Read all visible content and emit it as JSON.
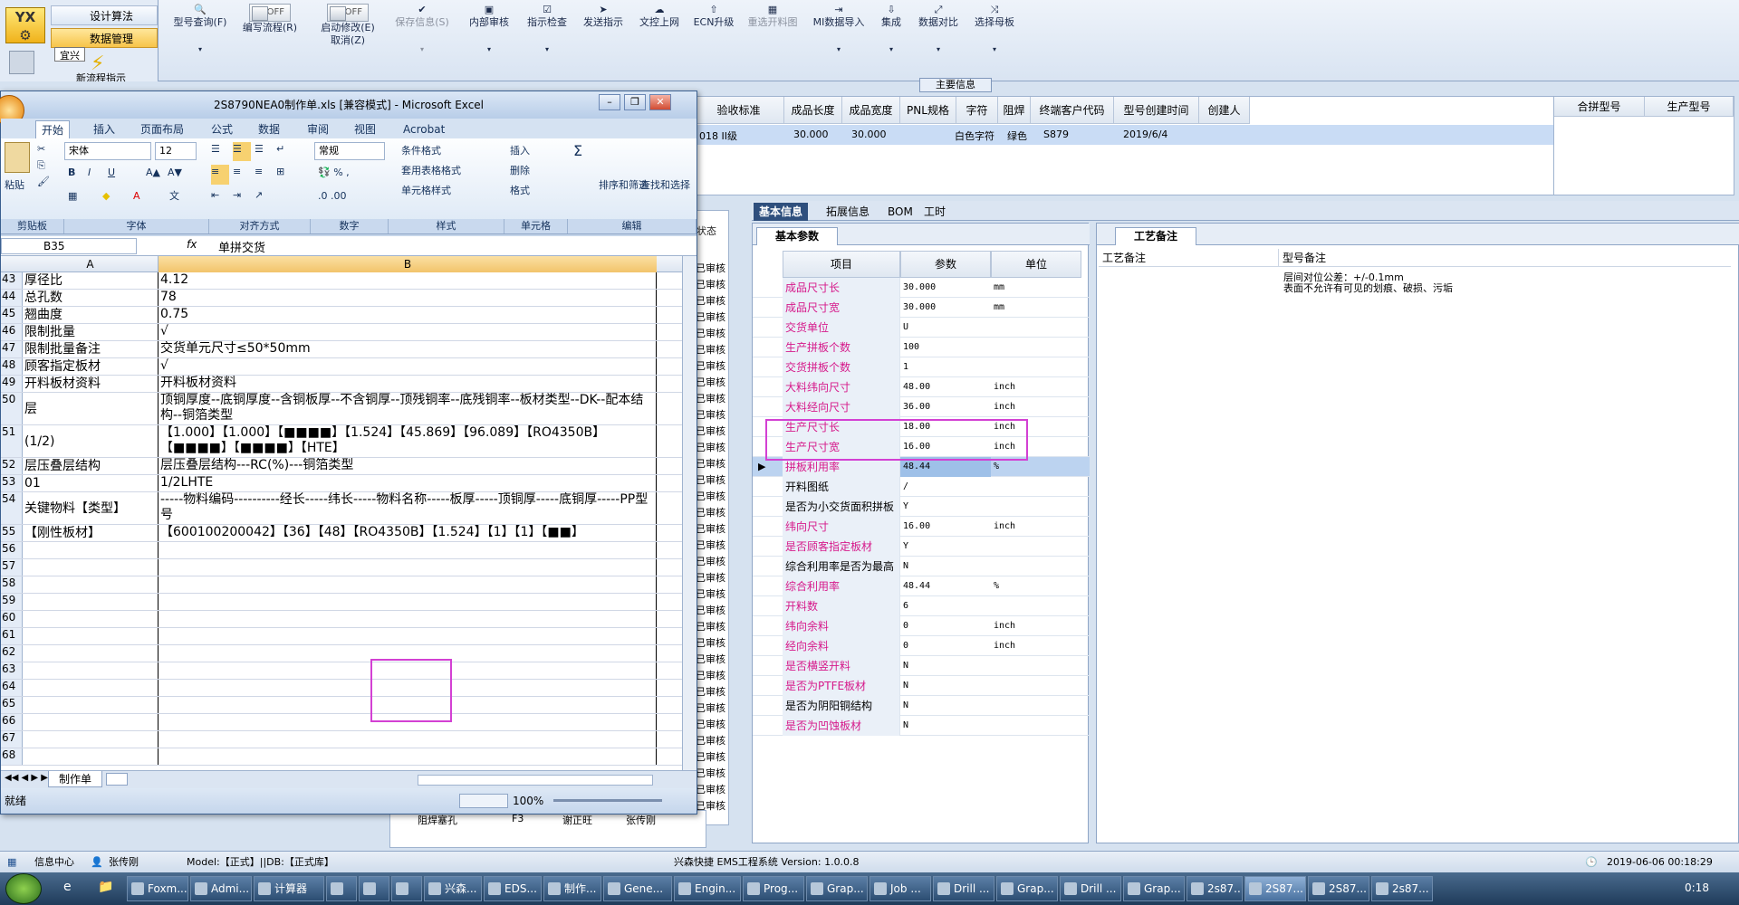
{
  "app_ribbon": {
    "nav": {
      "design": "设计算法",
      "data_mgmt": "数据管理",
      "tooltip": "宜兴",
      "new_flow": "新流程指示"
    },
    "buttons": [
      {
        "label": "型号查询(F)",
        "icon": "search-icon"
      },
      {
        "label": "编写流程(R)",
        "toggle": "OFF"
      },
      {
        "label": "启动修改(E)",
        "toggle": "OFF",
        "sub": "取消(Z)"
      },
      {
        "label": "保存信息(S)",
        "disabled": true
      },
      {
        "label": "内部审核"
      },
      {
        "label": "指示检查"
      },
      {
        "label": "发送指示"
      },
      {
        "label": "文控上网"
      },
      {
        "label": "ECN升级"
      },
      {
        "label": "重选开料图",
        "disabled": true
      },
      {
        "label": "MI数据导入"
      },
      {
        "label": "集成"
      },
      {
        "label": "数据对比"
      },
      {
        "label": "选择母板"
      }
    ],
    "main_info": "主要信息"
  },
  "top_grid": {
    "headers": [
      "验收标准",
      "成品长度",
      "成品宽度",
      "PNL规格",
      "字符",
      "阻焊",
      "终端客户代码",
      "型号创建时间",
      "创建人"
    ],
    "row": [
      "018 II级",
      "30.000",
      "30.000",
      "",
      "白色字符",
      "绿色",
      "S879",
      "2019/6/4",
      ""
    ],
    "merge_headers": [
      "合拼型号",
      "生产型号"
    ]
  },
  "status_col": {
    "header": "状态",
    "value": "已审核"
  },
  "tabs": [
    "基本信息",
    "拓展信息",
    "BOM",
    "工时"
  ],
  "params": {
    "tab": "基本参数",
    "headers": [
      "项目",
      "参数",
      "单位"
    ],
    "rows": [
      {
        "name": "成品尺寸长",
        "value": "30.000",
        "unit": "mm",
        "pink": true
      },
      {
        "name": "成品尺寸宽",
        "value": "30.000",
        "unit": "mm",
        "pink": true
      },
      {
        "name": "交货单位",
        "value": "U",
        "unit": "",
        "pink": true
      },
      {
        "name": "生产拼板个数",
        "value": "100",
        "unit": "",
        "pink": true
      },
      {
        "name": "交货拼板个数",
        "value": "1",
        "unit": "",
        "pink": true
      },
      {
        "name": "大料纬向尺寸",
        "value": "48.00",
        "unit": "inch",
        "pink": true
      },
      {
        "name": "大料经向尺寸",
        "value": "36.00",
        "unit": "inch",
        "pink": true
      },
      {
        "name": "生产尺寸长",
        "value": "18.00",
        "unit": "inch",
        "pink": true
      },
      {
        "name": "生产尺寸宽",
        "value": "16.00",
        "unit": "inch",
        "pink": true
      },
      {
        "name": "拼板利用率",
        "value": "48.44",
        "unit": "%",
        "pink": true,
        "selected": true
      },
      {
        "name": "开料图纸",
        "value": "/",
        "unit": "",
        "pink": false
      },
      {
        "name": "是否为小交货面积拼板",
        "value": "Y",
        "unit": "",
        "pink": false
      },
      {
        "name": "纬向尺寸",
        "value": "16.00",
        "unit": "inch",
        "pink": true
      },
      {
        "name": "是否顾客指定板材",
        "value": "Y",
        "unit": "",
        "pink": true
      },
      {
        "name": "综合利用率是否为最高",
        "value": "N",
        "unit": "",
        "pink": false
      },
      {
        "name": "综合利用率",
        "value": "48.44",
        "unit": "%",
        "pink": true
      },
      {
        "name": "开料数",
        "value": "6",
        "unit": "",
        "pink": true
      },
      {
        "name": "纬向余料",
        "value": "0",
        "unit": "inch",
        "pink": true
      },
      {
        "name": "经向余料",
        "value": "0",
        "unit": "inch",
        "pink": true
      },
      {
        "name": "是否横竖开料",
        "value": "N",
        "unit": "",
        "pink": true
      },
      {
        "name": "是否为PTFE板材",
        "value": "N",
        "unit": "",
        "pink": true
      },
      {
        "name": "是否为阴阳铜结构",
        "value": "N",
        "unit": "",
        "pink": false
      },
      {
        "name": "是否为凹蚀板材",
        "value": "N",
        "unit": "",
        "pink": true
      }
    ]
  },
  "remarks": {
    "tab": "工艺备注",
    "col1": "工艺备注",
    "col2": "型号备注",
    "text1": "层间对位公差：+/-0.1mm",
    "text2": "表面不允许有可见的划痕、破损、污垢"
  },
  "excel": {
    "title": "2S8790NEA0制作单.xls [兼容模式] - Microsoft Excel",
    "tabs": [
      "开始",
      "插入",
      "页面布局",
      "公式",
      "数据",
      "审阅",
      "视图",
      "Acrobat"
    ],
    "font": "宋体",
    "size": "12",
    "format": "常规",
    "groups": [
      "剪贴板",
      "字体",
      "对齐方式",
      "数字",
      "样式",
      "单元格",
      "编辑"
    ],
    "style_items": [
      "条件格式",
      "套用表格格式",
      "单元格样式"
    ],
    "cell_items": [
      "插入",
      "删除",
      "格式"
    ],
    "edit_items": [
      "排序和筛选",
      "查找和选择"
    ],
    "paste": "粘贴",
    "namebox": "B35",
    "fx": "fx",
    "formula": "单拼交货",
    "colA": "A",
    "colB": "B",
    "rows": [
      {
        "n": "43",
        "a": "厚径比",
        "b": "4.12"
      },
      {
        "n": "44",
        "a": "总孔数",
        "b": "78"
      },
      {
        "n": "45",
        "a": "翘曲度",
        "b": "0.75"
      },
      {
        "n": "46",
        "a": "限制批量",
        "b": "√"
      },
      {
        "n": "47",
        "a": "限制批量备注",
        "b": "交货单元尺寸≤50*50mm"
      },
      {
        "n": "48",
        "a": "顾客指定板材",
        "b": "√"
      },
      {
        "n": "49",
        "a": "开料板材资料",
        "b": "开料板材资料"
      },
      {
        "n": "50",
        "a": "层",
        "b": "顶铜厚度--底铜厚度--含铜板厚--不含铜厚--顶残铜率--底残铜率--板材类型--DK--配本结构--铜箔类型"
      },
      {
        "n": "51",
        "a": "(1/2)",
        "b": "【1.000】【1.000】【■■■■】【1.524】【45.869】【96.089】【RO4350B】【■■■■】【■■■■】【HTE】"
      },
      {
        "n": "52",
        "a": "层压叠层结构",
        "b": "层压叠层结构---RC(%)---铜箔类型"
      },
      {
        "n": "53",
        "a": "01",
        "b": "1/2LHTE"
      },
      {
        "n": "54",
        "a": "关键物料【类型】",
        "b": "-----物料编码----------经长-----纬长-----物料名称-----板厚-----顶铜厚-----底铜厚-----PP型号"
      },
      {
        "n": "55",
        "a": "【刚性板材】",
        "b": "【600100200042】【36】【48】【RO4350B】【1.524】【1】【1】【■■】"
      },
      {
        "n": "56",
        "a": "",
        "b": ""
      },
      {
        "n": "57",
        "a": "",
        "b": ""
      },
      {
        "n": "58",
        "a": "",
        "b": ""
      },
      {
        "n": "59",
        "a": "",
        "b": ""
      },
      {
        "n": "60",
        "a": "",
        "b": ""
      },
      {
        "n": "61",
        "a": "",
        "b": ""
      },
      {
        "n": "62",
        "a": "",
        "b": ""
      },
      {
        "n": "63",
        "a": "",
        "b": ""
      },
      {
        "n": "64",
        "a": "",
        "b": ""
      },
      {
        "n": "65",
        "a": "",
        "b": ""
      },
      {
        "n": "66",
        "a": "",
        "b": ""
      },
      {
        "n": "67",
        "a": "",
        "b": ""
      },
      {
        "n": "68",
        "a": "",
        "b": ""
      }
    ],
    "sheet_tab": "制作单",
    "status": "就绪",
    "zoom": "100%"
  },
  "bottom_list": {
    "row": [
      "阻焊塞孔",
      "F3",
      "谢正旺",
      "张传刚"
    ]
  },
  "app_status": {
    "info": "信息中心",
    "user": "张传刚",
    "model": "Model:【正式】||DB:【正式库】",
    "version": "兴森快捷 EMS工程系统 Version: 1.0.0.8",
    "datetime": "2019-06-06 00:18:29"
  },
  "taskbar": {
    "items": [
      "Foxm...",
      "Admi...",
      "计算器",
      "",
      "",
      "",
      "兴森...",
      "EDS...",
      "制作...",
      "Gene...",
      "Engin...",
      "Prog...",
      "Grap...",
      "Job ...",
      "Drill ...",
      "Grap...",
      "Drill ...",
      "Grap...",
      "2s87...",
      "2S87...",
      "2S87...",
      "2s87..."
    ],
    "clock": "0:18"
  }
}
